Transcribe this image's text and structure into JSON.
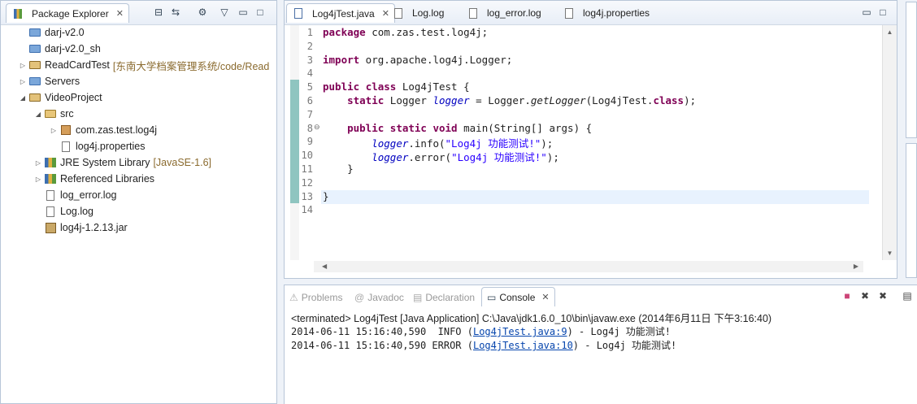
{
  "package_explorer": {
    "title": "Package Explorer",
    "tree": [
      {
        "label": "darj-v2.0",
        "decoration": "",
        "icon": "folder-icon",
        "depth": 0,
        "twisty": ""
      },
      {
        "label": "darj-v2.0_sh",
        "decoration": "",
        "icon": "folder-icon",
        "depth": 0,
        "twisty": ""
      },
      {
        "label": "ReadCardTest",
        "decoration": "[东南大学档案管理系统/code/Read",
        "icon": "project-icon",
        "depth": 0,
        "twisty": "▷"
      },
      {
        "label": "Servers",
        "decoration": "",
        "icon": "folder-icon",
        "depth": 0,
        "twisty": "▷"
      },
      {
        "label": "VideoProject",
        "decoration": "",
        "icon": "project-icon",
        "depth": 0,
        "twisty": "◢"
      },
      {
        "label": "src",
        "decoration": "",
        "icon": "source-folder-icon",
        "depth": 1,
        "twisty": "◢"
      },
      {
        "label": "com.zas.test.log4j",
        "decoration": "",
        "icon": "package-icon",
        "depth": 2,
        "twisty": "▷"
      },
      {
        "label": "log4j.properties",
        "decoration": "",
        "icon": "file-icon",
        "depth": 2,
        "twisty": ""
      },
      {
        "label": "JRE System Library",
        "decoration": "[JavaSE-1.6]",
        "icon": "library-icon",
        "depth": 1,
        "twisty": "▷"
      },
      {
        "label": "Referenced Libraries",
        "decoration": "",
        "icon": "library-icon",
        "depth": 1,
        "twisty": "▷"
      },
      {
        "label": "log_error.log",
        "decoration": "",
        "icon": "file-icon",
        "depth": 1,
        "twisty": ""
      },
      {
        "label": "Log.log",
        "decoration": "",
        "icon": "file-icon",
        "depth": 1,
        "twisty": ""
      },
      {
        "label": "log4j-1.2.13.jar",
        "decoration": "",
        "icon": "jar-icon",
        "depth": 1,
        "twisty": ""
      }
    ]
  },
  "editor": {
    "tabs": [
      "Log4jTest.java",
      "Log.log",
      "log_error.log",
      "log4j.properties"
    ],
    "active_tab": "Log4jTest.java",
    "line_numbers": [
      "1",
      "2",
      "3",
      "4",
      "5",
      "6",
      "7",
      "8",
      "9",
      "10",
      "11",
      "12",
      "13",
      "14"
    ],
    "code": [
      [
        {
          "t": "package",
          "c": "kw"
        },
        {
          "t": " com.zas.test.log4j;",
          "c": ""
        }
      ],
      [],
      [
        {
          "t": "import",
          "c": "kw"
        },
        {
          "t": " org.apache.log4j.Logger;",
          "c": ""
        }
      ],
      [],
      [
        {
          "t": "public",
          "c": "kw"
        },
        {
          "t": " ",
          "c": ""
        },
        {
          "t": "class",
          "c": "kw"
        },
        {
          "t": " Log4jTest {",
          "c": ""
        }
      ],
      [
        {
          "t": "    ",
          "c": ""
        },
        {
          "t": "static",
          "c": "kw"
        },
        {
          "t": " Logger ",
          "c": ""
        },
        {
          "t": "logger",
          "c": "fld"
        },
        {
          "t": " = Logger.",
          "c": ""
        },
        {
          "t": "getLogger",
          "c": "mth"
        },
        {
          "t": "(Log4jTest.",
          "c": ""
        },
        {
          "t": "class",
          "c": "kw"
        },
        {
          "t": ");",
          "c": ""
        }
      ],
      [],
      [
        {
          "t": "    ",
          "c": ""
        },
        {
          "t": "public",
          "c": "kw"
        },
        {
          "t": " ",
          "c": ""
        },
        {
          "t": "static",
          "c": "kw"
        },
        {
          "t": " ",
          "c": ""
        },
        {
          "t": "void",
          "c": "kw"
        },
        {
          "t": " main(String[] args) {",
          "c": ""
        }
      ],
      [
        {
          "t": "        ",
          "c": ""
        },
        {
          "t": "logger",
          "c": "fld"
        },
        {
          "t": ".info(",
          "c": ""
        },
        {
          "t": "\"Log4j 功能测试!\"",
          "c": "str"
        },
        {
          "t": ");",
          "c": ""
        }
      ],
      [
        {
          "t": "        ",
          "c": ""
        },
        {
          "t": "logger",
          "c": "fld"
        },
        {
          "t": ".error(",
          "c": ""
        },
        {
          "t": "\"Log4j 功能测试!\"",
          "c": "str"
        },
        {
          "t": ");",
          "c": ""
        }
      ],
      [
        {
          "t": "    }",
          "c": ""
        }
      ],
      [],
      [
        {
          "t": "}",
          "c": ""
        }
      ],
      []
    ]
  },
  "console": {
    "tabs": [
      {
        "label": "Problems",
        "icon": "problems-icon"
      },
      {
        "label": "Javadoc",
        "icon": "at-icon"
      },
      {
        "label": "Declaration",
        "icon": "declaration-icon"
      }
    ],
    "active_tab": "Console",
    "terminated_line": "<terminated> Log4jTest [Java Application] C:\\Java\\jdk1.6.0_10\\bin\\javaw.exe (2014年6月11日 下午3:16:40)",
    "output": [
      {
        "prefix": "2014-06-11 15:16:40,590  INFO (",
        "link": "Log4jTest.java:9",
        "suffix": ") - Log4j 功能测试!"
      },
      {
        "prefix": "2014-06-11 15:16:40,590 ERROR (",
        "link": "Log4jTest.java:10",
        "suffix": ") - Log4j 功能测试!"
      }
    ]
  },
  "colors": {
    "keyword": "#7f0055",
    "string": "#2a00ff",
    "field": "#0000c0",
    "link": "#0645ad",
    "decoration": "#8a6a2e"
  }
}
